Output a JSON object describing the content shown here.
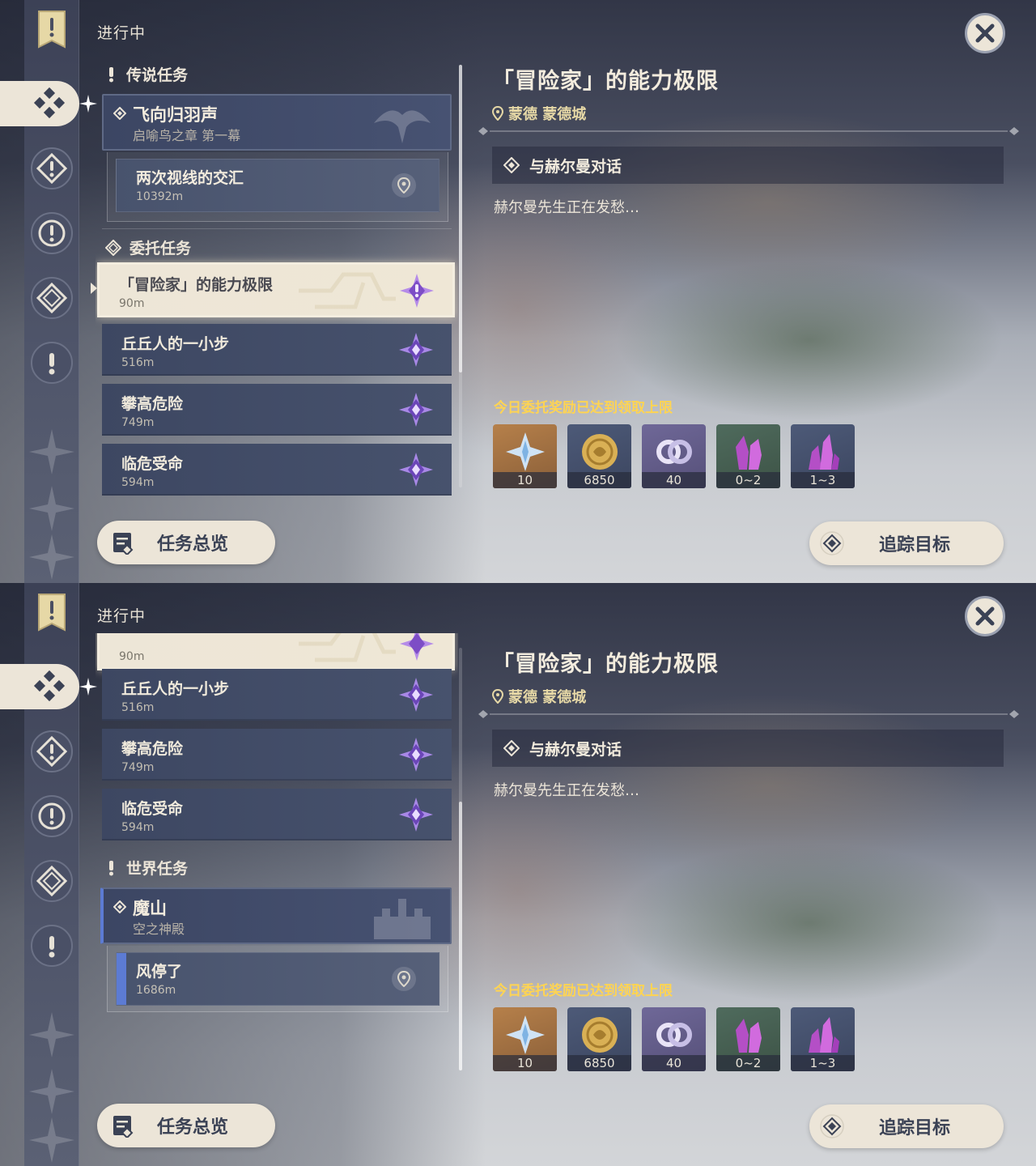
{
  "status_label": "进行中",
  "categories": {
    "legend": "传说任务",
    "commission": "委托任务",
    "world": "世界任务"
  },
  "legend_quest": {
    "title": "飞向归羽声",
    "subtitle": "启喻鸟之章 第一幕",
    "step": {
      "title": "两次视线的交汇",
      "distance": "10392m"
    }
  },
  "commissions": [
    {
      "title": "「冒险家」的能力极限",
      "distance": "90m",
      "selected": true
    },
    {
      "title": "丘丘人的一小步",
      "distance": "516m"
    },
    {
      "title": "攀高危险",
      "distance": "749m"
    },
    {
      "title": "临危受命",
      "distance": "594m"
    }
  ],
  "world_quest": {
    "title": "魔山",
    "subtitle": "空之神殿",
    "step": {
      "title": "风停了",
      "distance": "1686m"
    }
  },
  "detail": {
    "title": "「冒险家」的能力极限",
    "location": "蒙德 蒙德城",
    "objective": "与赫尔曼对话",
    "description": "赫尔曼先生正在发愁…",
    "reward_note": "今日委托奖励已达到领取上限",
    "rewards": [
      {
        "icon": "primogem-icon",
        "count": "10",
        "bg": "#b6804a"
      },
      {
        "icon": "mora-coin-icon",
        "count": "6850",
        "bg": "#4d5a78"
      },
      {
        "icon": "friendship-exp-icon",
        "count": "40",
        "bg": "#6f6898"
      },
      {
        "icon": "ore-crystal-icon",
        "count": "0~2",
        "bg": "#4f6b5d"
      },
      {
        "icon": "ore-crystal-icon",
        "count": "1~3",
        "bg": "#4d5a78"
      }
    ]
  },
  "buttons": {
    "overview": "任务总览",
    "track": "追踪目标"
  },
  "colors": {
    "panel_cream": "#ece5d8",
    "accent_gold": "#ffd452",
    "location_gold": "#e6d8a6",
    "commission_purple": "#8c5fd6"
  }
}
